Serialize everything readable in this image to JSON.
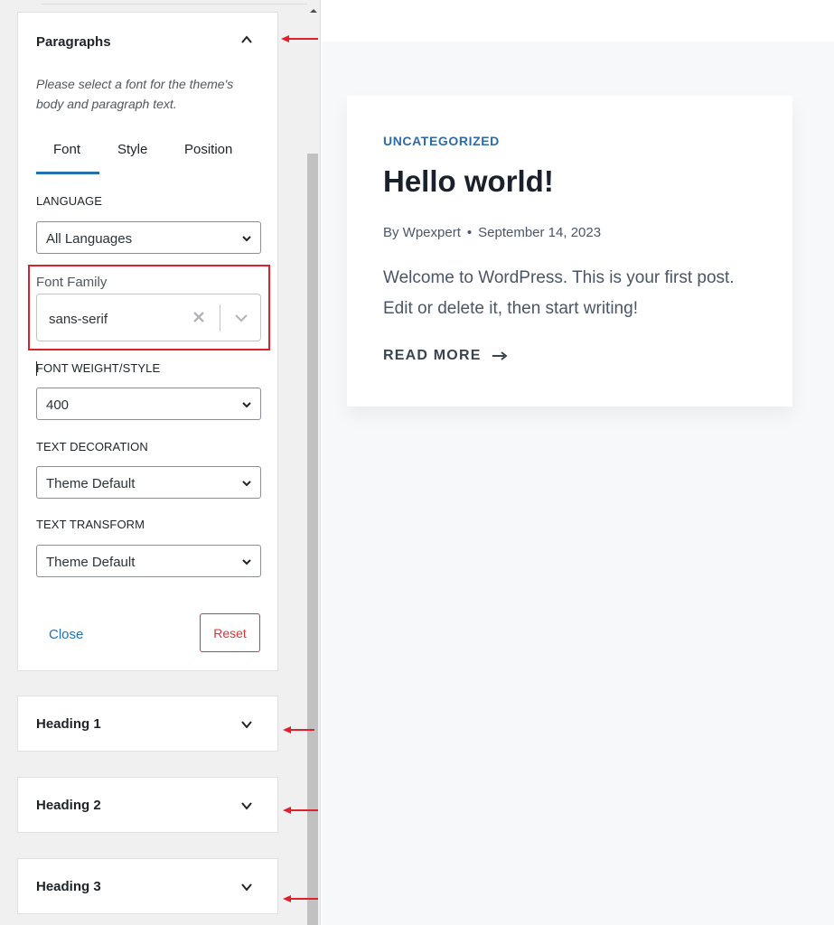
{
  "customizer": {
    "paragraphs": {
      "title": "Paragraphs",
      "description": "Please select a font for the theme's body and paragraph text.",
      "tabs": [
        "Font",
        "Style",
        "Position"
      ],
      "active_tab": "Font",
      "language": {
        "label": "LANGUAGE",
        "value": "All Languages"
      },
      "font_family": {
        "label": "Font Family",
        "value": "sans-serif"
      },
      "font_weight": {
        "label": "FONT WEIGHT/STYLE",
        "value": "400"
      },
      "text_decoration": {
        "label": "TEXT DECORATION",
        "value": "Theme Default"
      },
      "text_transform": {
        "label": "TEXT TRANSFORM",
        "value": "Theme Default"
      },
      "close_label": "Close",
      "reset_label": "Reset"
    },
    "sections": [
      {
        "title": "Heading 1"
      },
      {
        "title": "Heading 2"
      },
      {
        "title": "Heading 3"
      }
    ]
  },
  "preview": {
    "category": "UNCATEGORIZED",
    "title": "Hello world!",
    "author": "By Wpexpert",
    "date": "September 14, 2023",
    "excerpt": "Welcome to WordPress. This is your first post. Edit or delete it, then start writing!",
    "read_more": "READ MORE"
  },
  "colors": {
    "accent_blue": "#2271b1",
    "highlight_red": "#d9232b",
    "reset_red": "#d63638",
    "category_blue": "#2e6ba5"
  },
  "icons": {
    "collapse": "chevron-up-icon",
    "expand": "chevron-down-icon",
    "clear": "close-x-icon",
    "read_more": "long-arrow-right-icon",
    "annotation": "red-arrow-left-icon"
  }
}
